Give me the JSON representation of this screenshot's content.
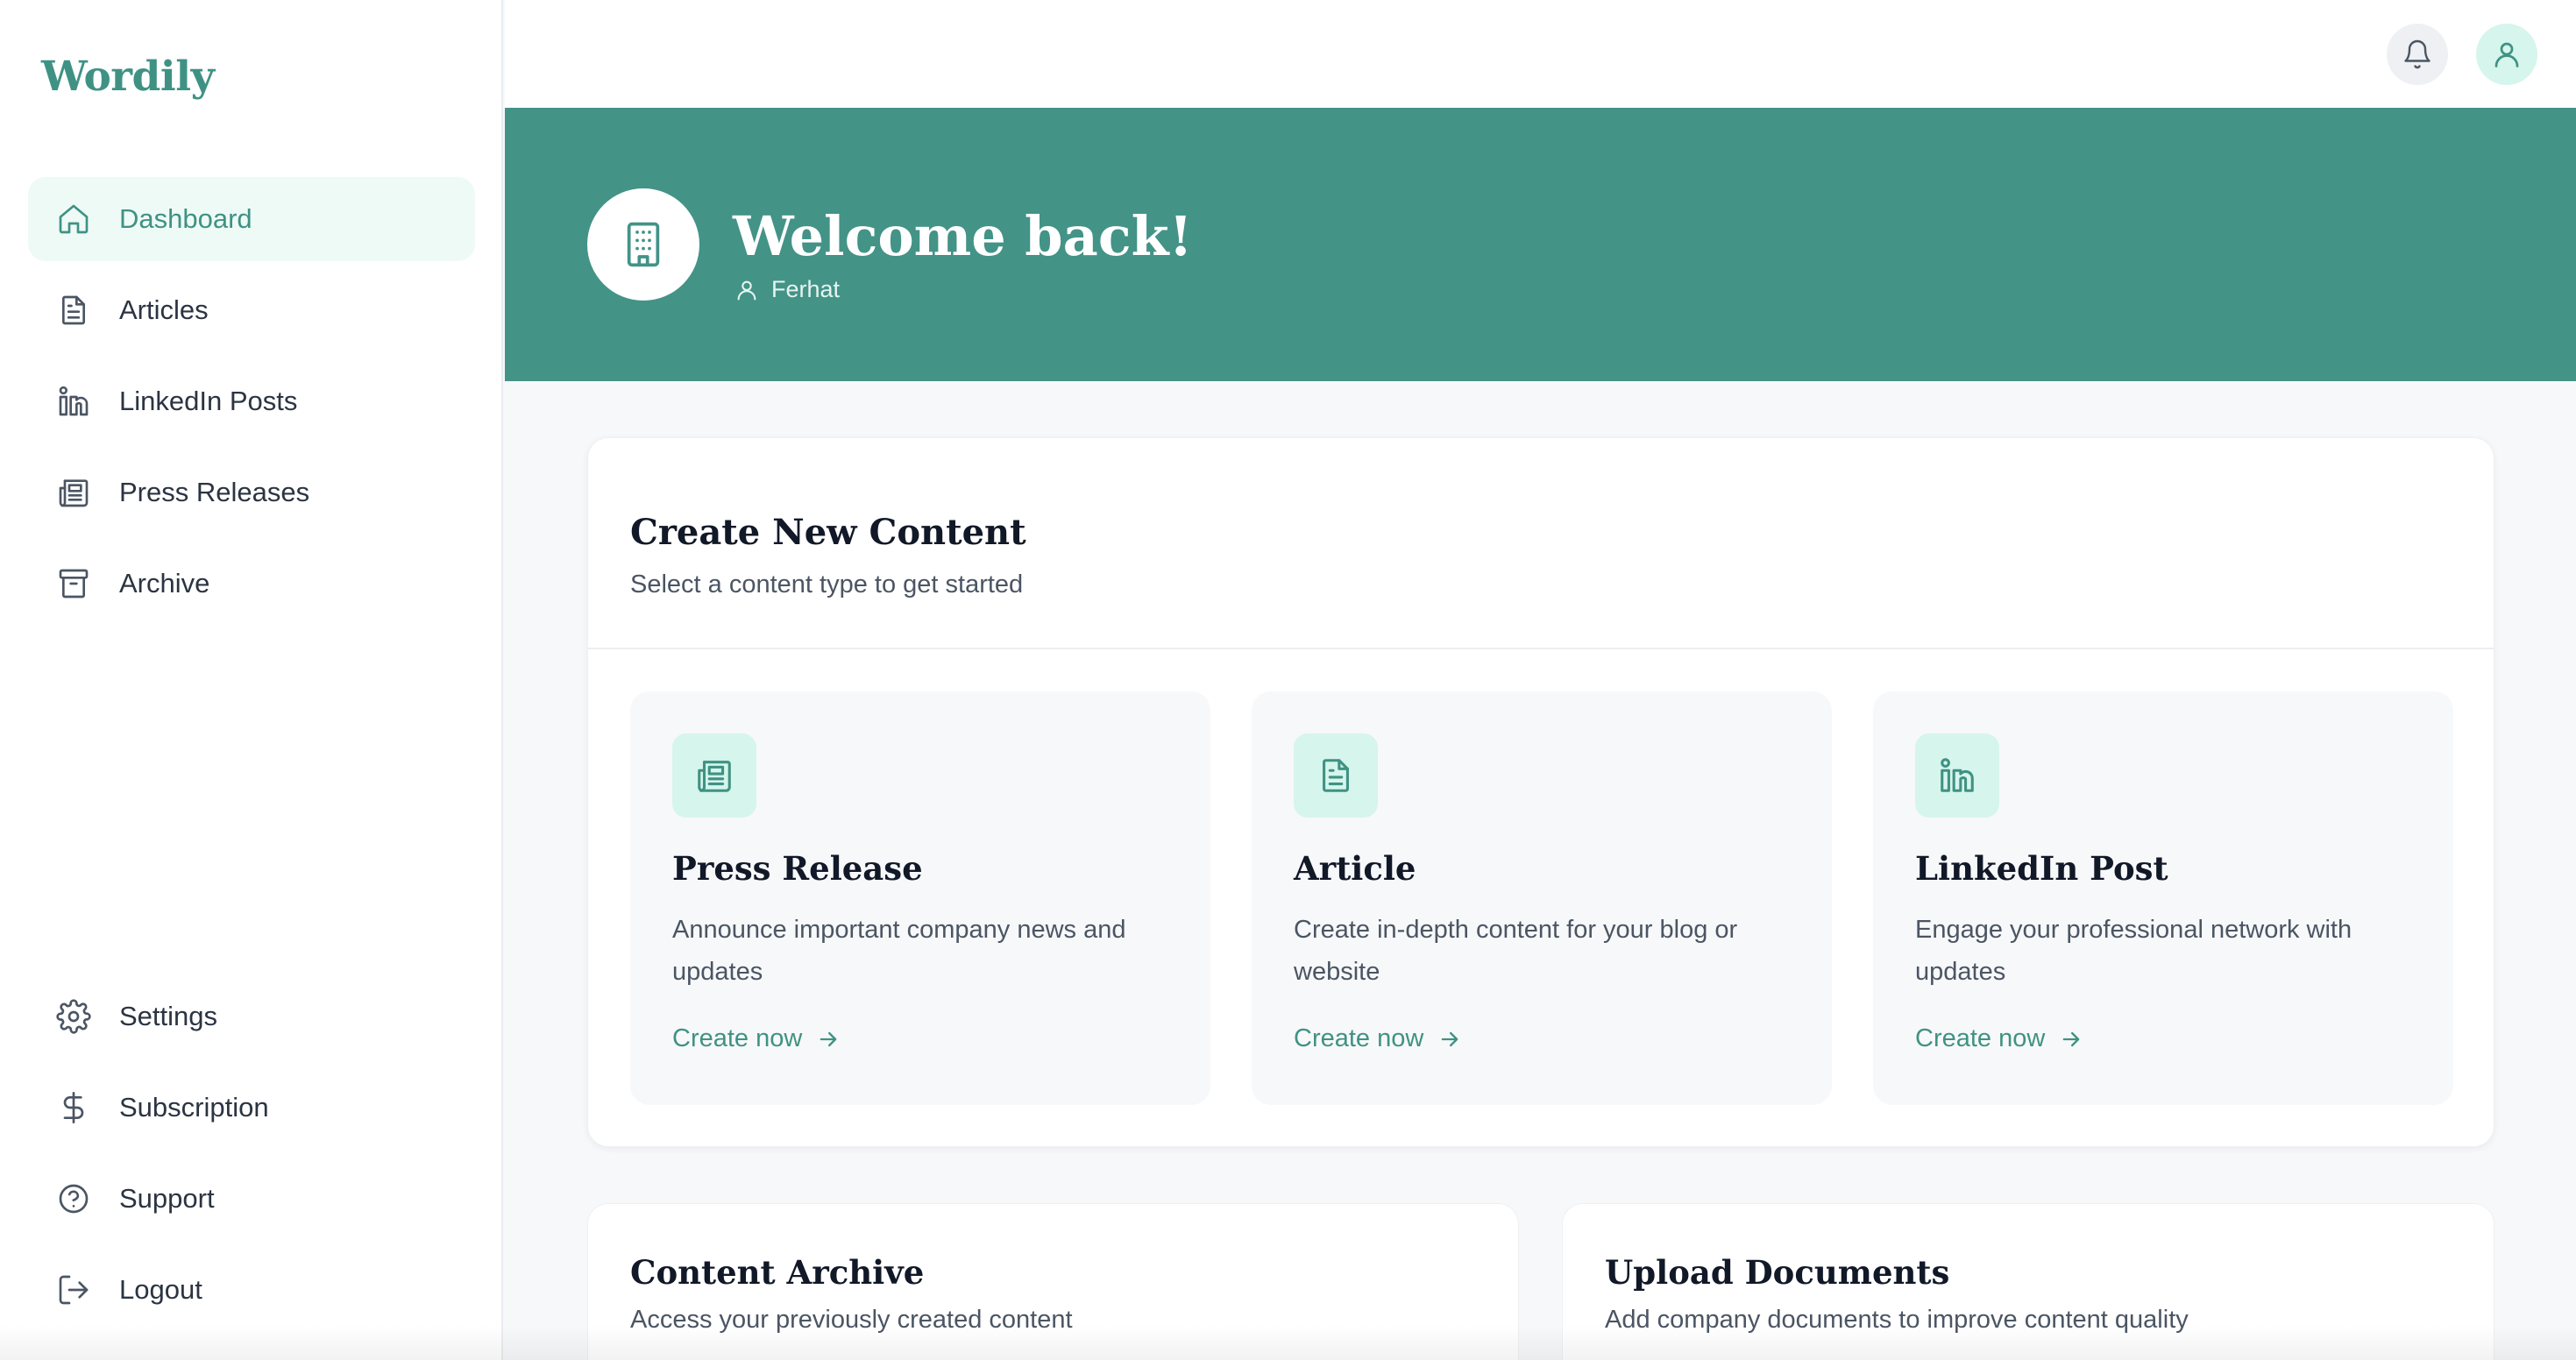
{
  "app": {
    "logo": "Wordily"
  },
  "sidebar": {
    "main_items": [
      {
        "label": "Dashboard",
        "icon": "home-icon",
        "active": true
      },
      {
        "label": "Articles",
        "icon": "file-text-icon",
        "active": false
      },
      {
        "label": "LinkedIn Posts",
        "icon": "linkedin-icon",
        "active": false
      },
      {
        "label": "Press Releases",
        "icon": "newspaper-icon",
        "active": false
      },
      {
        "label": "Archive",
        "icon": "archive-icon",
        "active": false
      }
    ],
    "bottom_items": [
      {
        "label": "Settings",
        "icon": "gear-icon"
      },
      {
        "label": "Subscription",
        "icon": "dollar-icon"
      },
      {
        "label": "Support",
        "icon": "help-circle-icon"
      },
      {
        "label": "Logout",
        "icon": "logout-icon"
      }
    ]
  },
  "topbar": {
    "notifications_icon": "bell-icon",
    "profile_icon": "user-icon"
  },
  "hero": {
    "icon": "building-icon",
    "title": "Welcome back!",
    "user_name": "Ferhat"
  },
  "create_content": {
    "title": "Create New Content",
    "subtitle": "Select a content type to get started",
    "types": [
      {
        "title": "Press Release",
        "description": "Announce important company news and updates",
        "link": "Create now",
        "icon": "newspaper-icon"
      },
      {
        "title": "Article",
        "description": "Create in-depth content for your blog or website",
        "link": "Create now",
        "icon": "file-text-icon"
      },
      {
        "title": "LinkedIn Post",
        "description": "Engage your professional network with updates",
        "link": "Create now",
        "icon": "linkedin-icon"
      }
    ]
  },
  "bottom_cards": [
    {
      "title": "Content Archive",
      "subtitle": "Access your previously created content"
    },
    {
      "title": "Upload Documents",
      "subtitle": "Add company documents to improve content quality"
    }
  ],
  "colors": {
    "brand": "#3f9283",
    "hero_bg": "#439387",
    "active_bg": "#eefaf6",
    "icon_tile_bg": "#d6f5ec"
  }
}
